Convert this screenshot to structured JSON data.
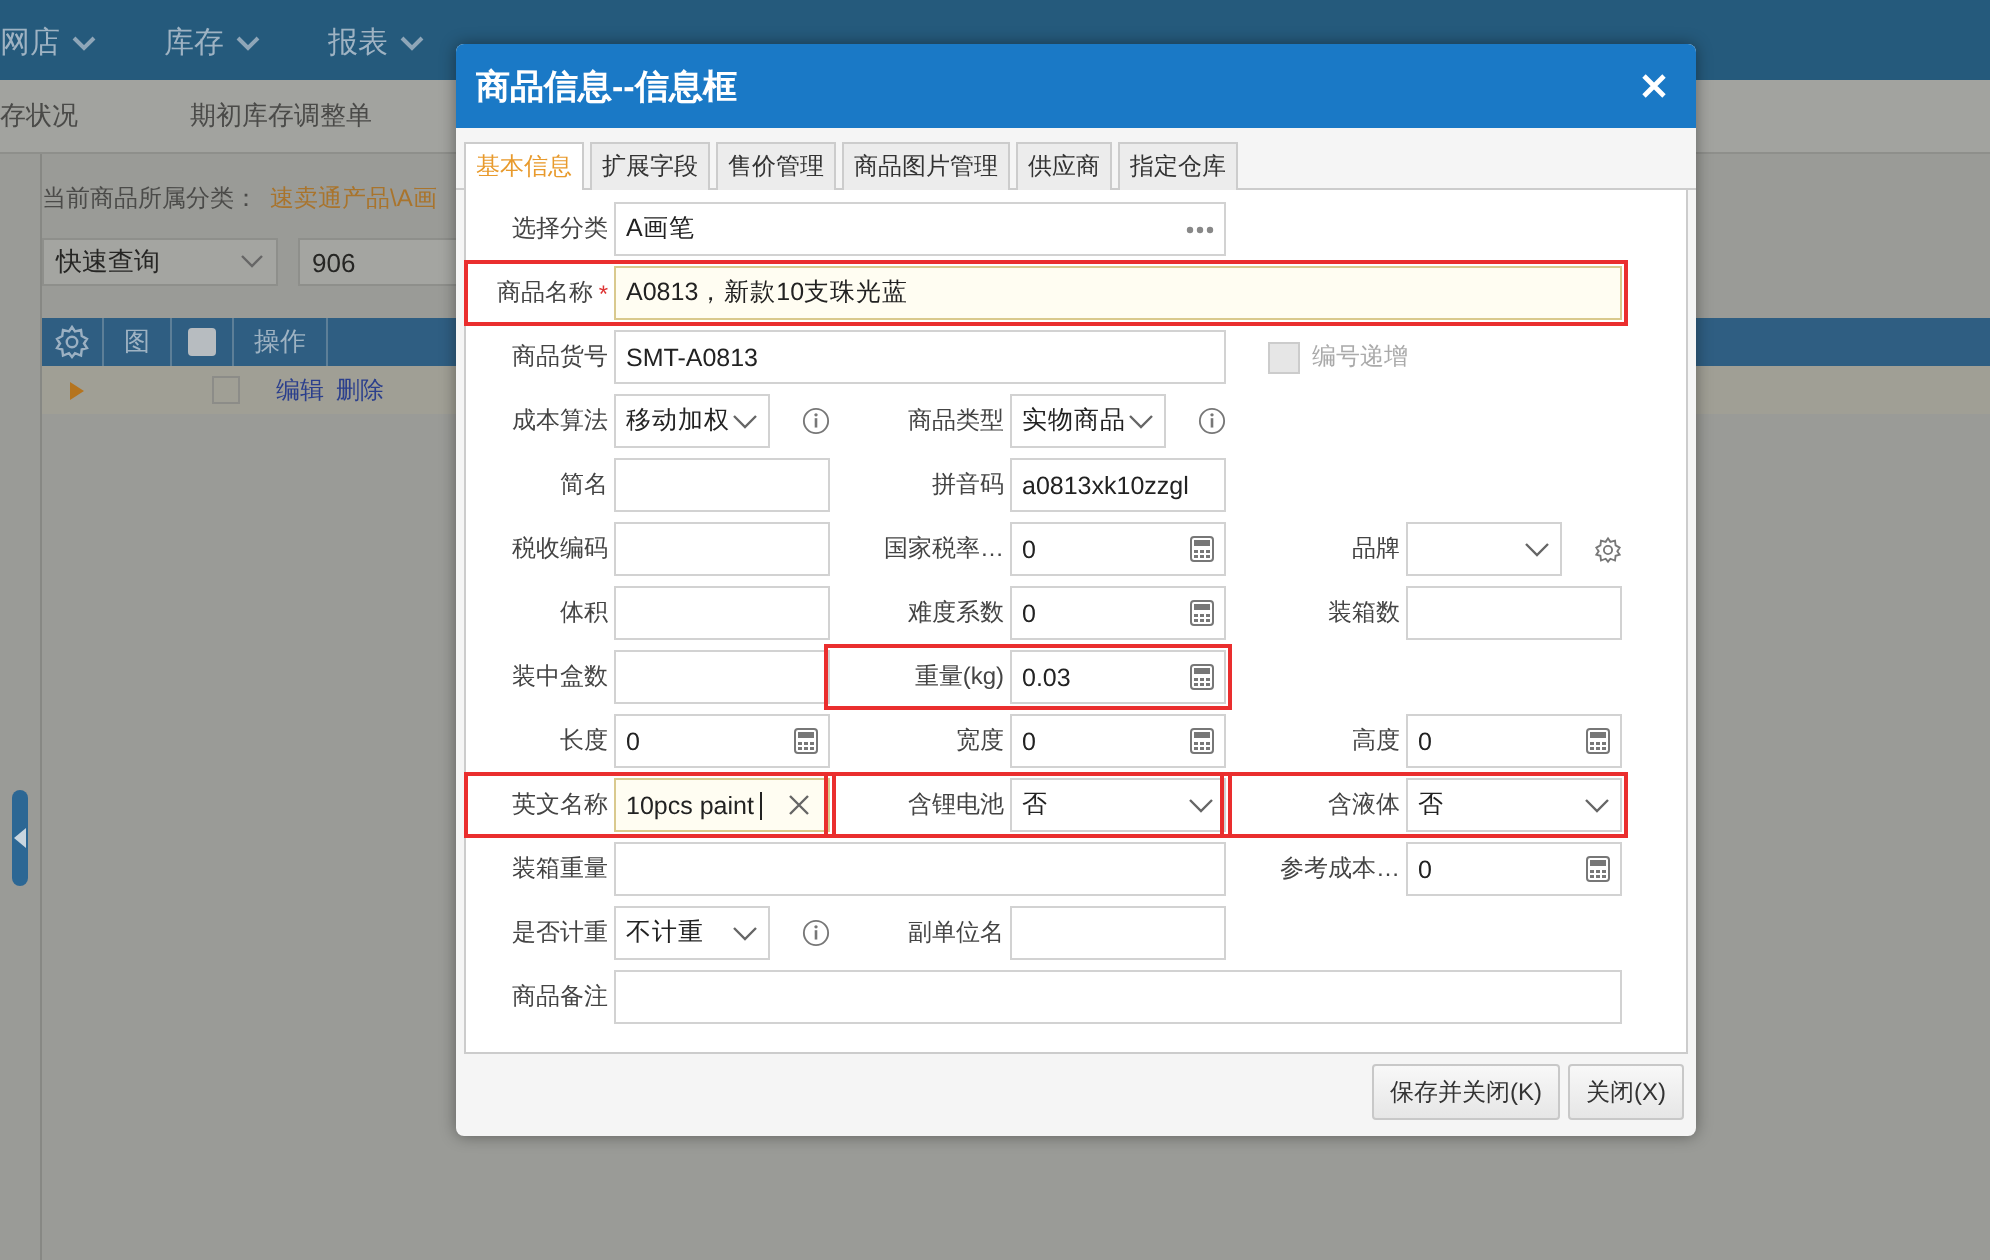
{
  "nav": {
    "items": [
      {
        "label": "网店"
      },
      {
        "label": "库存"
      },
      {
        "label": "报表"
      }
    ]
  },
  "subnav": {
    "items": [
      "存状况",
      "期初库存调整单"
    ]
  },
  "category": {
    "label": "当前商品所属分类：",
    "value": "速卖通产品\\A画"
  },
  "query": {
    "mode": "快速查询",
    "value": "906"
  },
  "table": {
    "columns": [
      {
        "kind": "gear"
      },
      {
        "kind": "text",
        "label": "图"
      },
      {
        "kind": "checkbox",
        "checked": false
      },
      {
        "kind": "text",
        "label": "操作"
      }
    ],
    "rows": [
      {
        "checked": false,
        "actions": [
          "编辑",
          "删除"
        ]
      }
    ]
  },
  "dialog": {
    "title": "商品信息--信息框",
    "tabs": [
      {
        "label": "基本信息",
        "selected": true
      },
      {
        "label": "扩展字段",
        "selected": false
      },
      {
        "label": "售价管理",
        "selected": false
      },
      {
        "label": "商品图片管理",
        "selected": false
      },
      {
        "label": "供应商",
        "selected": false
      },
      {
        "label": "指定仓库",
        "selected": false
      }
    ],
    "rows": [
      [
        {
          "label": "选择分类",
          "kind": "lookup",
          "value": "A画笔"
        }
      ],
      [
        {
          "label": "商品名称",
          "required_mark": "*",
          "kind": "text",
          "value": "A0813，新款10支珠光蓝",
          "highlighted": true,
          "focused": true
        }
      ],
      [
        {
          "label": "商品货号",
          "kind": "text",
          "value": "SMT-A0813"
        },
        {
          "kind": "checkbox",
          "label": "编号递增",
          "checked": false,
          "disabled": true
        }
      ],
      [
        {
          "label": "成本算法",
          "kind": "select",
          "value": "移动加权",
          "has_help": true
        },
        {
          "label": "商品类型",
          "kind": "select",
          "value": "实物商品",
          "has_help": true
        }
      ],
      [
        {
          "label": "简名",
          "kind": "text"
        },
        {
          "label": "拼音码",
          "kind": "text",
          "value": "a0813xk10zzgl"
        }
      ],
      [
        {
          "label": "税收编码",
          "kind": "text"
        },
        {
          "label": "国家税率…",
          "kind": "number",
          "value": "0"
        },
        {
          "label": "品牌",
          "kind": "select",
          "configurable": true
        }
      ],
      [
        {
          "label": "体积",
          "kind": "text"
        },
        {
          "label": "难度系数",
          "kind": "number",
          "value": "0"
        },
        {
          "label": "装箱数",
          "kind": "text"
        }
      ],
      [
        {
          "label": "装中盒数",
          "kind": "text"
        },
        {
          "label": "重量(kg)",
          "kind": "number",
          "value": "0.03",
          "highlighted": true
        }
      ],
      [
        {
          "label": "长度",
          "kind": "number",
          "value": "0"
        },
        {
          "label": "宽度",
          "kind": "number",
          "value": "0"
        },
        {
          "label": "高度",
          "kind": "number",
          "value": "0"
        }
      ],
      [
        {
          "label": "英文名称",
          "kind": "text",
          "value": "10pcs paint",
          "focused": true,
          "caret": true,
          "clearable": true,
          "highlighted": true
        },
        {
          "label": "含锂电池",
          "kind": "select",
          "value": "否",
          "highlighted": true
        },
        {
          "label": "含液体",
          "kind": "select",
          "value": "否",
          "highlighted": true
        }
      ],
      [
        {
          "label": "装箱重量",
          "kind": "text"
        },
        {
          "label": "参考成本…",
          "kind": "number",
          "value": "0"
        }
      ],
      [
        {
          "label": "是否计重",
          "kind": "select",
          "value": "不计重",
          "has_help": true
        },
        {
          "label": "副单位名",
          "kind": "text"
        }
      ],
      [
        {
          "label": "商品备注",
          "kind": "text"
        }
      ]
    ],
    "buttons": [
      {
        "label": "保存并关闭(K)"
      },
      {
        "label": "关闭(X)"
      }
    ]
  }
}
